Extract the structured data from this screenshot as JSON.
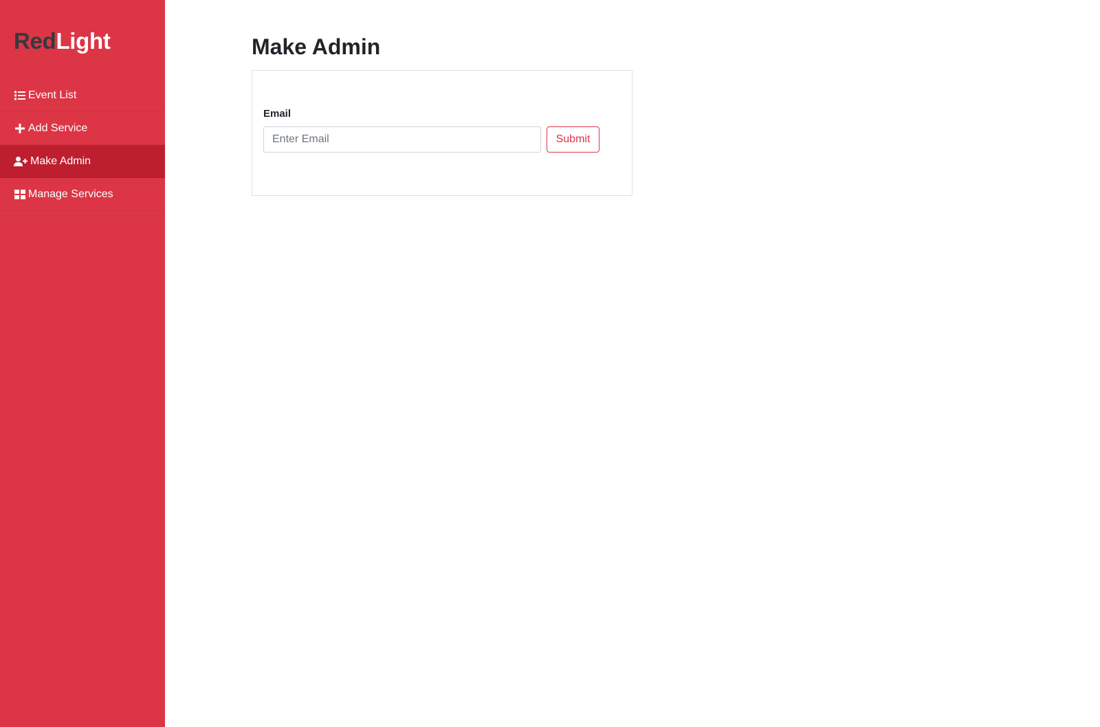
{
  "brand": {
    "part1": "Red",
    "part2": "Light"
  },
  "sidebar": {
    "items": [
      {
        "label": "Event List",
        "icon": "list-icon",
        "active": false
      },
      {
        "label": "Add Service",
        "icon": "plus-icon",
        "active": false
      },
      {
        "label": "Make Admin",
        "icon": "user-plus-icon",
        "active": true
      },
      {
        "label": "Manage Services",
        "icon": "grid-icon",
        "active": false
      }
    ]
  },
  "main": {
    "title": "Make Admin",
    "form": {
      "email_label": "Email",
      "email_value": "",
      "email_placeholder": "Enter Email",
      "submit_label": "Submit"
    }
  },
  "colors": {
    "sidebar_bg": "#dc3545",
    "sidebar_active_bg": "#bd1f2f",
    "brand_dark": "#343a40",
    "accent": "#dc3545"
  }
}
